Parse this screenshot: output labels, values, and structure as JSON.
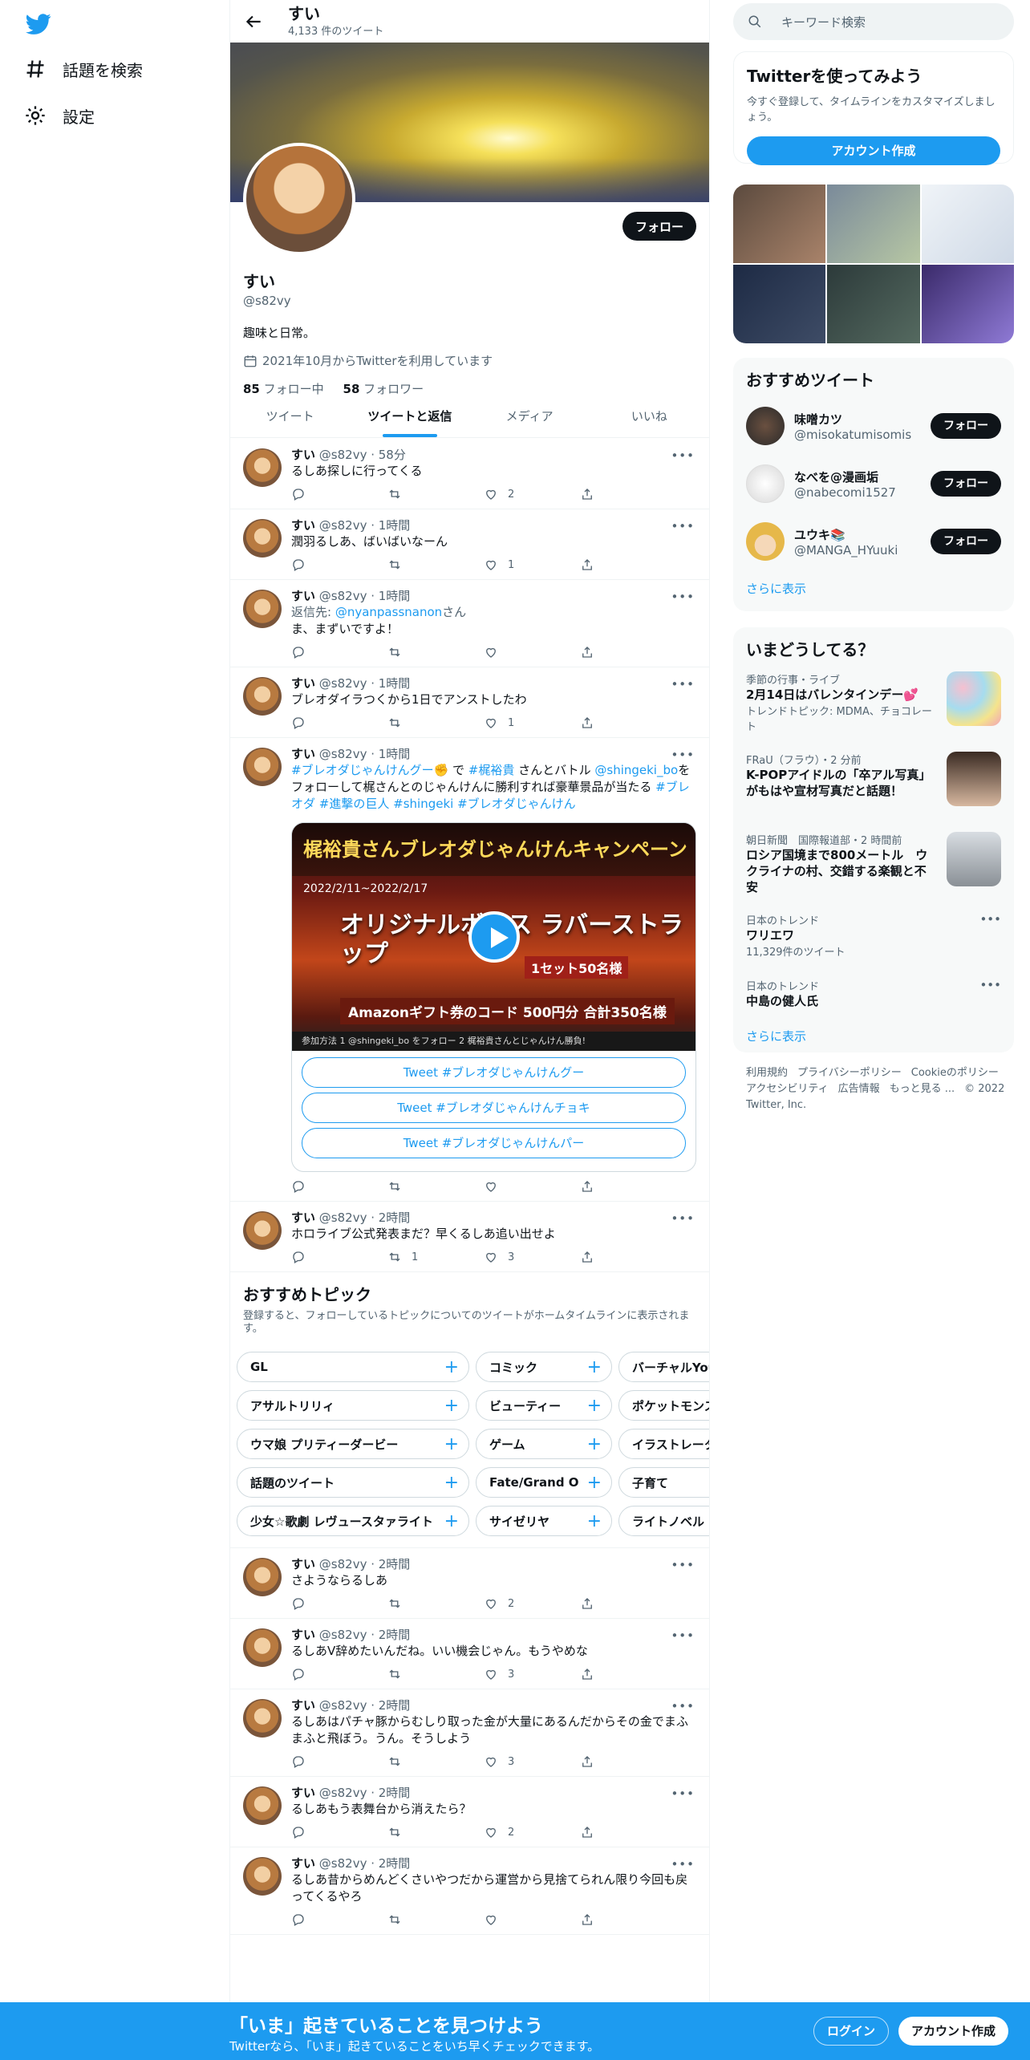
{
  "nav": {
    "explore": "話題を検索",
    "settings": "設定"
  },
  "header": {
    "title": "すい",
    "tweet_count": "4,133 件のツイート"
  },
  "profile": {
    "name": "すい",
    "handle": "@s82vy",
    "bio": "趣味と日常。",
    "joined": "2021年10月からTwitterを利用しています",
    "following_count": "85",
    "following_label": "フォロー中",
    "followers_count": "58",
    "followers_label": "フォロワー",
    "follow_button": "フォロー"
  },
  "tabs": [
    "ツイート",
    "ツイートと返信",
    "メディア",
    "いいね"
  ],
  "tweets": [
    {
      "name": "すい",
      "handle": "@s82vy",
      "time": "58分",
      "text": "るしあ探しに行ってくる",
      "retweets": "",
      "likes": "2"
    },
    {
      "name": "すい",
      "handle": "@s82vy",
      "time": "1時間",
      "text": "潤羽るしあ、ばいばいなーん",
      "retweets": "",
      "likes": "1"
    },
    {
      "name": "すい",
      "handle": "@s82vy",
      "time": "1時間",
      "reply_prefix": "返信先: ",
      "reply_to": "@nyanpassnanon",
      "reply_suffix": "さん",
      "text": "ま、まずいですよ！",
      "retweets": "",
      "likes": ""
    },
    {
      "name": "すい",
      "handle": "@s82vy",
      "time": "1時間",
      "text": "ブレオダイラつくから1日でアンストしたわ",
      "retweets": "",
      "likes": "1"
    },
    {
      "name": "すい",
      "handle": "@s82vy",
      "time": "1時間",
      "parts": [
        "#ブレオダじゃんけんグー✊",
        " で ",
        "#梶裕貴",
        " さんとバトル ",
        "@shingeki_bo",
        "をフォローして梶さんとのじゃんけんに勝利すれば豪華景品が当たる ",
        "#ブレオダ",
        " ",
        "#進撃の巨人",
        " ",
        "#shingeki",
        " ",
        "#ブレオダじゃんけん"
      ],
      "card": {
        "title": "梶裕貴さんブレオダじゃんけんキャンペーン",
        "date": "2022/2/11~2022/2/17",
        "headline": "オリジナルボイス ラバーストラップ",
        "set": "1セット50名様",
        "gift": "Amazonギフト券のコード 500円分 合計350名様",
        "footer": "参加方法  1 @shingeki_bo をフォロー  2 梶裕貴さんとじゃんけん勝負!",
        "buttons": [
          "Tweet #ブレオダじゃんけんグー",
          "Tweet #ブレオダじゃんけんチョキ",
          "Tweet #ブレオダじゃんけんパー"
        ]
      },
      "retweets": "",
      "likes": ""
    },
    {
      "name": "すい",
      "handle": "@s82vy",
      "time": "2時間",
      "text": "ホロライブ公式発表まだ？早くるしあ追い出せよ",
      "retweets": "1",
      "likes": "3"
    }
  ],
  "topics": {
    "title": "おすすめトピック",
    "desc": "登録すると、フォローしているトピックについてのツイートがホームタイムラインに表示されます。",
    "rows": [
      [
        "GL",
        "コミック",
        "バーチャルYouTuber"
      ],
      [
        "アサルトリリィ",
        "ビューティー",
        "ポケットモンスター"
      ],
      [
        "ウマ娘 プリティーダービー",
        "ゲーム",
        "イラストレーター"
      ],
      [
        "話題のツイート",
        "Fate/Grand Order",
        "子育て"
      ],
      [
        "少女☆歌劇 レヴュースタァライト",
        "サイゼリヤ",
        "ライトノベル"
      ]
    ]
  },
  "tweets2": [
    {
      "name": "すい",
      "handle": "@s82vy",
      "time": "2時間",
      "text": "さようならるしあ",
      "retweets": "",
      "likes": "2"
    },
    {
      "name": "すい",
      "handle": "@s82vy",
      "time": "2時間",
      "text": "るしあV辞めたいんだね。いい機会じゃん。もうやめな",
      "retweets": "",
      "likes": "3"
    },
    {
      "name": "すい",
      "handle": "@s82vy",
      "time": "2時間",
      "text": "るしあはパチャ豚からむしり取った金が大量にあるんだからその金でまふまふと飛ぼう。うん。そうしよう",
      "retweets": "",
      "likes": "3"
    },
    {
      "name": "すい",
      "handle": "@s82vy",
      "time": "2時間",
      "text": "るしあもう表舞台から消えたら？",
      "retweets": "",
      "likes": "2"
    },
    {
      "name": "すい",
      "handle": "@s82vy",
      "time": "2時間",
      "text": "るしあ昔からめんどくさいやつだから運営から見捨てられん限り今回も戻ってくるやろ",
      "retweets": "",
      "likes": ""
    }
  ],
  "right": {
    "search_placeholder": "キーワード検索",
    "try_title": "Twitterを使ってみよう",
    "try_desc": "今すぐ登録して、タイムラインをカスタマイズしましょう。",
    "try_button": "アカウント作成",
    "rec_title": "おすすめツイート",
    "rec_users": [
      {
        "name": "味噌カツ",
        "handle": "@misokatumisomis",
        "button": "フォロー"
      },
      {
        "name": "なべを@漫画垢",
        "handle": "@nabecomi1527",
        "button": "フォロー"
      },
      {
        "name": "ユウキ📚",
        "handle": "@MANGA_HYuuki",
        "button": "フォロー"
      }
    ],
    "show_more": "さらに表示",
    "trend_title": "いまどうしてる？",
    "trends": [
      {
        "cat": "季節の行事・ライブ",
        "name": "2月14日はバレンタインデー💕",
        "sub": "トレンドトピック: MDMA、チョコレート"
      },
      {
        "cat": "FRaU（フラウ）・2 分前",
        "name": "K-POPアイドルの「卒アル写真」がもはや宣材写真だと話題！",
        "sub": ""
      },
      {
        "cat": "朝日新聞　国際報道部・2 時間前",
        "name": "ロシア国境まで800メートル　ウクライナの村、交錯する楽観と不安",
        "sub": ""
      },
      {
        "cat": "日本のトレンド",
        "name": "ワリエワ",
        "sub": "11,329件のツイート"
      },
      {
        "cat": "日本のトレンド",
        "name": "中島の健人氏",
        "sub": ""
      }
    ],
    "footer_links": [
      "利用規約",
      "プライバシーポリシー",
      "Cookieのポリシー",
      "アクセシビリティ",
      "広告情報",
      "もっと見る ...",
      "© 2022 Twitter, Inc."
    ]
  },
  "bottom": {
    "title": "「いま」起きていることを見つけよう",
    "sub": "Twitterなら、「いま」起きていることをいち早くチェックできます。",
    "login": "ログイン",
    "signup": "アカウント作成"
  },
  "colors": {
    "accent": "#1d9bf0",
    "text": "#0f1419",
    "muted": "#536471"
  }
}
